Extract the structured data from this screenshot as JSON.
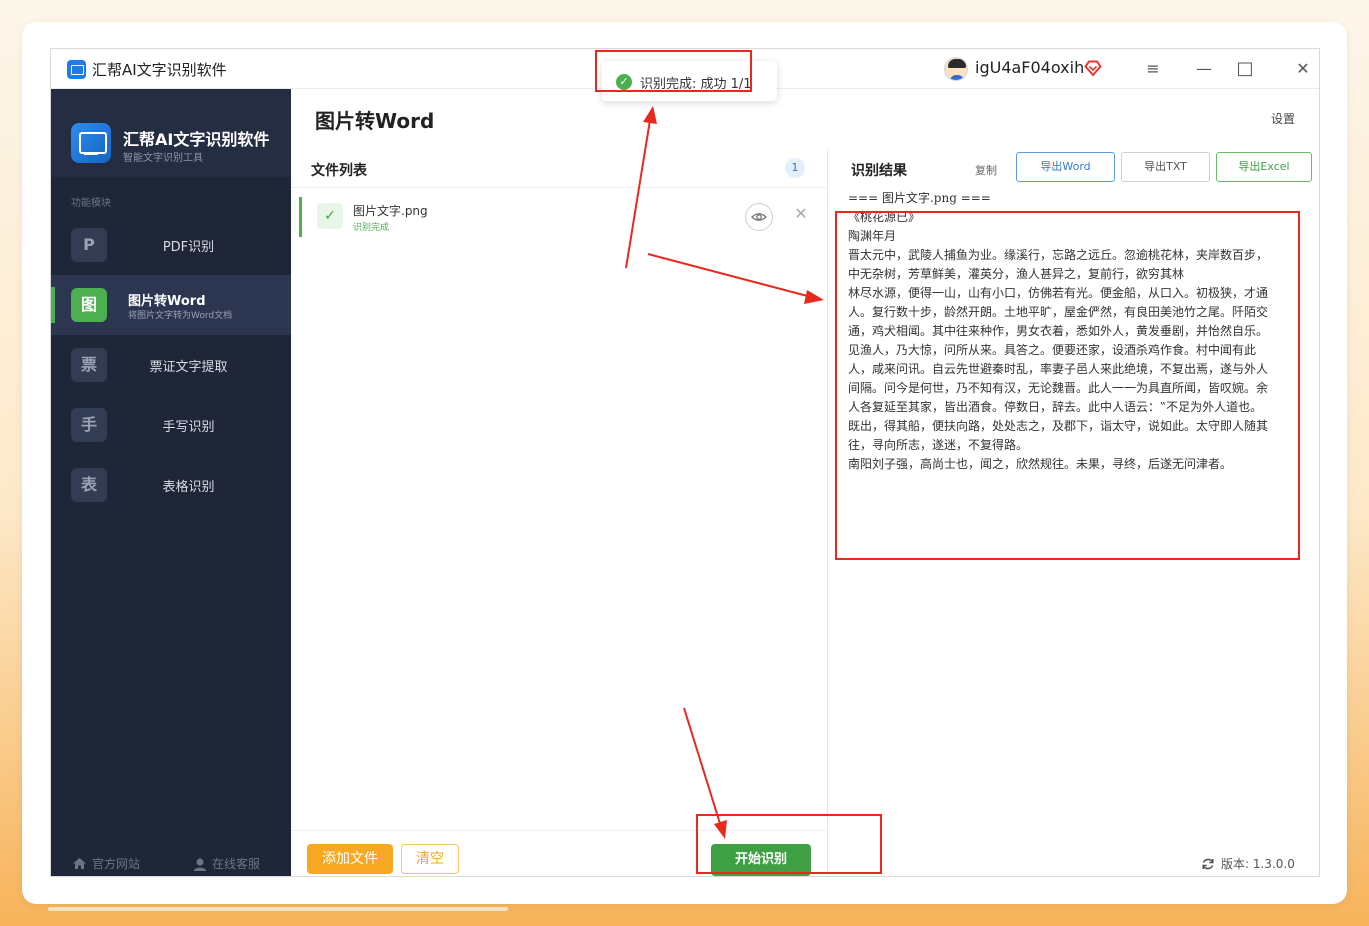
{
  "app": {
    "title": "汇帮AI文字识别软件",
    "username": "igU4aF04oxih"
  },
  "window_controls": {
    "menu": "≡",
    "minimize": "—",
    "maximize": "□",
    "close": "✕"
  },
  "sidebar": {
    "brand_name": "汇帮AI文字识别软件",
    "brand_sub": "智能文字识别工具",
    "section_label": "功能模块",
    "items": [
      {
        "icon": "P",
        "label": "PDF识别"
      },
      {
        "icon": "图",
        "label": "图片转Word",
        "sub": "将图片文字转为Word文档",
        "active": true
      },
      {
        "icon": "票",
        "label": "票证文字提取"
      },
      {
        "icon": "手",
        "label": "手写识别"
      },
      {
        "icon": "表",
        "label": "表格识别"
      }
    ],
    "footer": {
      "website": "官方网站",
      "service": "在线客服"
    }
  },
  "main": {
    "page_title": "图片转Word",
    "settings": "设置",
    "file_list": {
      "title": "文件列表",
      "count": "1",
      "files": [
        {
          "name": "图片文字.png",
          "status": "识别完成"
        }
      ],
      "add_button": "添加文件",
      "clear_button": "清空",
      "start_button": "开始识别"
    },
    "result": {
      "title": "识别结果",
      "copy": "复制",
      "export_word": "导出Word",
      "export_txt": "导出TXT",
      "export_excel": "导出Excel",
      "text": "=== 图片文字.png ===\n《桃花源已》\n陶渊年月\n晋太元中，武陵人捕鱼为业。缘溪行，忘路之远丘。忽逾桃花林，夹岸数百步，中无杂树，芳草鲜美，灌英分，渔人甚异之，复前行，欲穷其林\n林尽水源，便得一山，山有小口，仿佛若有光。便金船，从口入。初极狭，才通人。复行数十步，龄然开朗。土地平旷，屋金俨然，有良田美池竹之尾。阡陌交通，鸡犬相闻。其中往来种作，男女衣着，悉如外人，黄发垂剧，并怡然自乐。\n见渔人，乃大惊，问所从来。具答之。便要还家，设酒杀鸡作食。村中闻有此人，咸来问讯。自云先世避秦时乱，率妻子邑人来此绝境，不复出焉，遂与外人间隔。问今是何世，乃不知有汉，无论魏晋。此人一一为具直所闻，皆叹婉。余人各复延至其家，皆出酒食。停数日，辞去。此中人语云：‟不足为外人道也。\n既出，得其船，便扶向路，处处志之，及郡下，诣太守，说如此。太守即人随其往，寻向所志，遂迷，不复得路。\n南阳刘子强，高尚士也，闻之，欣然规往。未果，寻终，后遂无问津者。",
      "version": "版本: 1.3.0.0"
    }
  },
  "toast": {
    "text": "识别完成: 成功 1/1"
  },
  "colors": {
    "accent_green": "#4caf50",
    "sidebar_bg": "#1f2637",
    "annotation_red": "#e8291d",
    "add_orange": "#f7a823"
  }
}
